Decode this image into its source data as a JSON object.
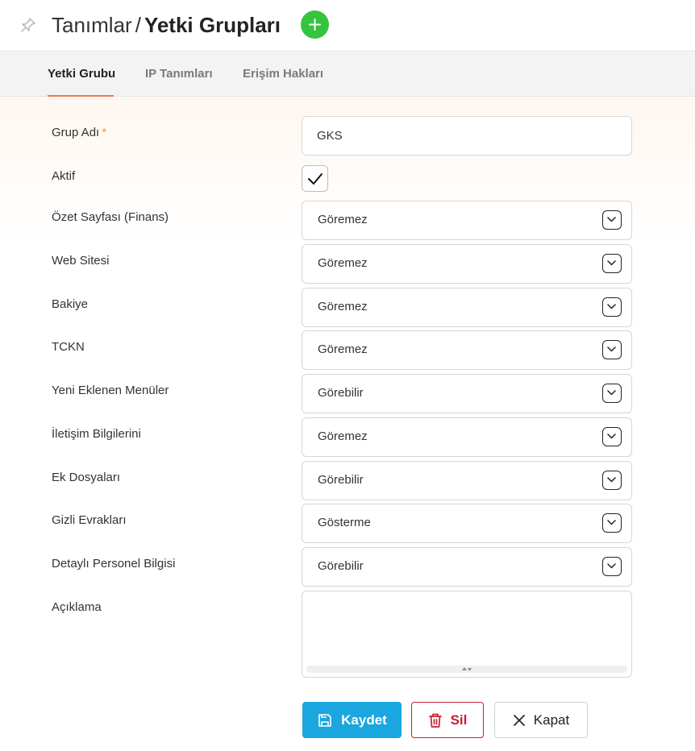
{
  "header": {
    "breadcrumb_parent": "Tanımlar",
    "separator": "/",
    "title": "Yetki Grupları",
    "add_icon": "plus-icon",
    "pin_icon": "pin-icon",
    "add_color": "#35c43d"
  },
  "tabs": [
    {
      "label": "Yetki Grubu",
      "active": true
    },
    {
      "label": "IP Tanımları",
      "active": false
    },
    {
      "label": "Erişim Hakları",
      "active": false
    }
  ],
  "form": {
    "group_name": {
      "label": "Grup Adı",
      "required_mark": "*",
      "value": "GKS"
    },
    "active": {
      "label": "Aktif",
      "checked": true
    },
    "permissions": [
      {
        "label": "Özet Sayfası (Finans)",
        "value": "Göremez"
      },
      {
        "label": "Web Sitesi",
        "value": "Göremez"
      },
      {
        "label": "Bakiye",
        "value": "Göremez"
      },
      {
        "label": "TCKN",
        "value": "Göremez"
      },
      {
        "label": "Yeni Eklenen Menüler",
        "value": "Görebilir"
      },
      {
        "label": "İletişim Bilgilerini",
        "value": "Göremez"
      },
      {
        "label": "Ek Dosyaları",
        "value": "Görebilir"
      },
      {
        "label": "Gizli Evrakları",
        "value": "Gösterme"
      },
      {
        "label": "Detaylı Personel Bilgisi",
        "value": "Görebilir"
      }
    ],
    "description": {
      "label": "Açıklama",
      "value": ""
    }
  },
  "actions": {
    "save_label": "Kaydet",
    "delete_label": "Sil",
    "close_label": "Kapat",
    "save_color": "#1aa6df",
    "delete_color": "#c8202e"
  }
}
